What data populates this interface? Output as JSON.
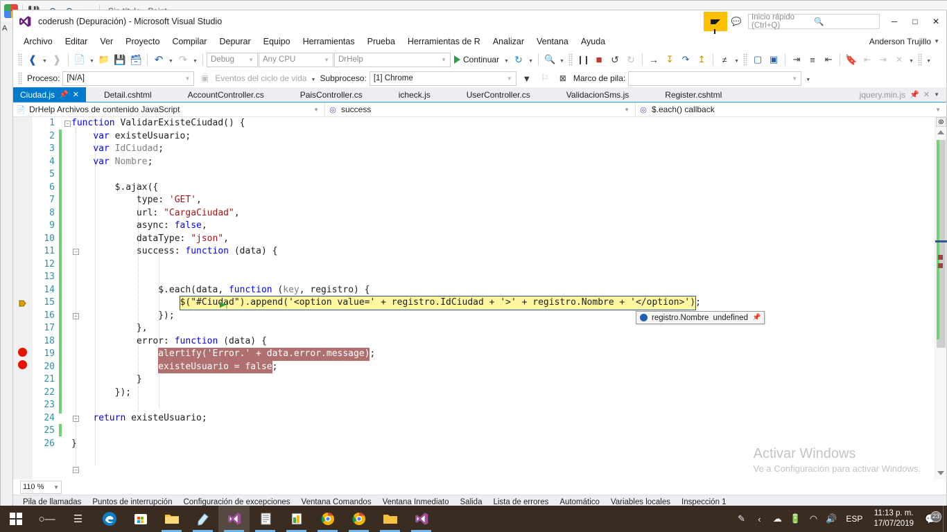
{
  "background_window": {
    "app_icon": "paint-icon",
    "title": "Sin título - Paint",
    "quick_access": [
      "save-icon",
      "undo-icon",
      "redo-icon",
      "chevron-down-icon"
    ],
    "side_letter": "A"
  },
  "vs_window": {
    "icon": "visual-studio-icon",
    "title": "coderush (Depuración) - Microsoft Visual Studio",
    "feedback_icon": "feedback-funnel-icon",
    "feedback_secondary_icon": "send-feedback-icon",
    "quick_launch_placeholder": "Inicio rápido (Ctrl+Q)",
    "quick_launch_value": "",
    "search_icon": "search-icon",
    "window_controls": {
      "minimize": "─",
      "maximize": "□",
      "close": "✕"
    },
    "account": "Anderson Trujillo"
  },
  "menubar": {
    "items": [
      "Archivo",
      "Editar",
      "Ver",
      "Proyecto",
      "Compilar",
      "Depurar",
      "Equipo",
      "Herramientas",
      "Prueba",
      "Herramientas de R",
      "Analizar",
      "Ventana",
      "Ayuda"
    ]
  },
  "toolbar": {
    "navigate_back_icon": "navigate-back-icon",
    "navigate_forward_icon": "navigate-forward-icon",
    "new_item_icon": "new-item-icon",
    "open_icon": "open-folder-icon",
    "save_icon": "save-icon",
    "save_all_icon": "save-all-icon",
    "undo_icon": "undo-icon",
    "redo_icon": "redo-icon",
    "configuration": "Debug",
    "platform": "Any CPU",
    "startup_project": "DrHelp",
    "continue_label": "Continuar",
    "continue_icon": "play-icon",
    "restart_icon": "restart-icon",
    "attach_icon": "attach-to-process-icon",
    "break_all_icon": "pause-icon",
    "stop_icon": "stop-debugging-icon",
    "restart_debug_icon": "restart-debugging-icon",
    "show_next_statement_icon": "show-next-statement-icon",
    "step_into_icon": "step-into-icon",
    "step_over_icon": "step-over-icon",
    "step_out_icon": "step-out-icon",
    "line_numbers_icon": "line-numbers-icon",
    "comment_icon": "comment-selection-icon",
    "uncomment_icon": "uncomment-selection-icon",
    "indent_icon": "increase-indent-icon",
    "outdent_icon": "decrease-indent-icon",
    "outline_icon": "outline-icon",
    "bookmark_icon": "bookmark-icon",
    "prev_bookmark_icon": "previous-bookmark-icon",
    "next_bookmark_icon": "next-bookmark-icon",
    "clear_bookmarks_icon": "clear-bookmarks-icon"
  },
  "debug_toolbar": {
    "process_label": "Proceso:",
    "process_value": "[N/A]",
    "lifecycle_events_icon": "lifecycle-events-icon",
    "lifecycle_events_label": "Eventos del ciclo de vida",
    "thread_label": "Subproceso:",
    "thread_value": "[1] Chrome",
    "filter_icon": "filter-threads-icon",
    "flag_icon": "flag-thread-icon",
    "no_flag_icon": "unflag-threads-icon",
    "stack_frame_label": "Marco de pila:",
    "stack_frame_value": ""
  },
  "tabs": {
    "items": [
      {
        "label": "Ciudad.js",
        "active": true,
        "pin_icon": "pin-icon",
        "close_icon": "close-icon"
      },
      {
        "label": "Detail.cshtml",
        "active": false
      },
      {
        "label": "AccountController.cs",
        "active": false
      },
      {
        "label": "PaisController.cs",
        "active": false
      },
      {
        "label": "icheck.js",
        "active": false
      },
      {
        "label": "UserController.cs",
        "active": false
      },
      {
        "label": "ValidacionSms.js",
        "active": false
      },
      {
        "label": "Register.cshtml",
        "active": false
      }
    ],
    "overflow": {
      "label": "jquery.min.js",
      "pin_icon": "pin-icon",
      "close_icon": "close-icon",
      "dropdown_icon": "chevron-down-icon"
    }
  },
  "navbar": {
    "project_icon": "javascript-file-icon",
    "project": "DrHelp Archivos de contenido JavaScript",
    "member_icon": "method-icon",
    "member": "success",
    "sub_member_icon": "method-icon",
    "sub_member": "$.each() callback"
  },
  "editor": {
    "language": "javascript",
    "zoom": "110 %",
    "current_line": 15,
    "breakpoint_lines": [
      19,
      20
    ],
    "lines": [
      {
        "n": 1,
        "text": "function ValidarExisteCiudad() {"
      },
      {
        "n": 2,
        "text": "    var existeUsuario;"
      },
      {
        "n": 3,
        "text": "    var IdCiudad;"
      },
      {
        "n": 4,
        "text": "    var Nombre;"
      },
      {
        "n": 5,
        "text": ""
      },
      {
        "n": 6,
        "text": "        $.ajax({"
      },
      {
        "n": 7,
        "text": "            type: 'GET',"
      },
      {
        "n": 8,
        "text": "            url: \"CargaCiudad\","
      },
      {
        "n": 9,
        "text": "            async: false,"
      },
      {
        "n": 10,
        "text": "            dataType: \"json\","
      },
      {
        "n": 11,
        "text": "            success: function (data) {"
      },
      {
        "n": 12,
        "text": ""
      },
      {
        "n": 13,
        "text": ""
      },
      {
        "n": 14,
        "text": "                $.each(data, function (key, registro) {"
      },
      {
        "n": 15,
        "text": "                    $(\"#Ciudad\").append('<option value=' + registro.IdCiudad + '>' + registro.Nombre + '</option>');"
      },
      {
        "n": 16,
        "text": "                });"
      },
      {
        "n": 17,
        "text": "            },"
      },
      {
        "n": 18,
        "text": "            error: function (data) {"
      },
      {
        "n": 19,
        "text": "                alertify('Error.' + data.error.message);"
      },
      {
        "n": 20,
        "text": "                existeUsuario = false;"
      },
      {
        "n": 21,
        "text": "            }"
      },
      {
        "n": 22,
        "text": "        });"
      },
      {
        "n": 23,
        "text": ""
      },
      {
        "n": 24,
        "text": "    return existeUsuario;"
      },
      {
        "n": 25,
        "text": ""
      },
      {
        "n": 26,
        "text": "}"
      }
    ],
    "datatip": {
      "icon": "datatip-bullet-icon",
      "expression": "registro.Nombre",
      "value": "undefined",
      "pin_icon": "pin-to-source-icon"
    },
    "scrollbar": {
      "split_icon": "split-view-icon",
      "up_icon": "scroll-up-icon",
      "down_icon": "scroll-down-icon"
    }
  },
  "watermark": {
    "title": "Activar Windows",
    "subtitle": "Ve a Configuración para activar Windows."
  },
  "bottom_tool_tabs": {
    "items": [
      "Pila de llamadas",
      "Puntos de interrupción",
      "Configuración de excepciones",
      "Ventana Comandos",
      "Ventana Inmediato",
      "Salida",
      "Lista de errores",
      "Automático",
      "Variables locales",
      "Inspección 1"
    ]
  },
  "taskbar": {
    "start_icon": "windows-start-icon",
    "search_icon": "search-icon",
    "task_view_icon": "task-view-icon",
    "apps": [
      {
        "icon": "edge-icon",
        "running": false
      },
      {
        "icon": "microsoft-store-icon",
        "running": false
      },
      {
        "icon": "file-explorer-icon",
        "running": true
      },
      {
        "icon": "paint-icon",
        "running": true
      },
      {
        "icon": "visual-studio-icon",
        "running": true,
        "active": true
      },
      {
        "icon": "word-document-icon",
        "running": true
      },
      {
        "icon": "excel-icon",
        "running": true
      },
      {
        "icon": "chrome-icon",
        "running": true
      },
      {
        "icon": "chrome-icon",
        "running": true
      },
      {
        "icon": "folder-icon",
        "running": true
      },
      {
        "icon": "visual-studio-icon",
        "running": true
      }
    ],
    "tray": {
      "pen_icon": "pen-icon",
      "show_hidden_icon": "show-hidden-icons-icon",
      "onedrive_icon": "onedrive-icon",
      "battery_icon": "battery-charging-icon",
      "network_icon": "wifi-icon",
      "volume_icon": "volume-icon",
      "language": "ESP",
      "time": "11:13 p. m.",
      "date": "17/07/2019",
      "notifications_icon": "action-center-icon",
      "notification_count": "23"
    }
  },
  "colors": {
    "vs_accent": "#007acc",
    "feedback_yellow": "#fcc000",
    "current_line": "#fff6a0",
    "breakpoint_red": "#e51400",
    "breakpoint_highlight": "#b07070",
    "changed_marker_green": "#6fd36f",
    "taskbar": "#3b2c22"
  }
}
